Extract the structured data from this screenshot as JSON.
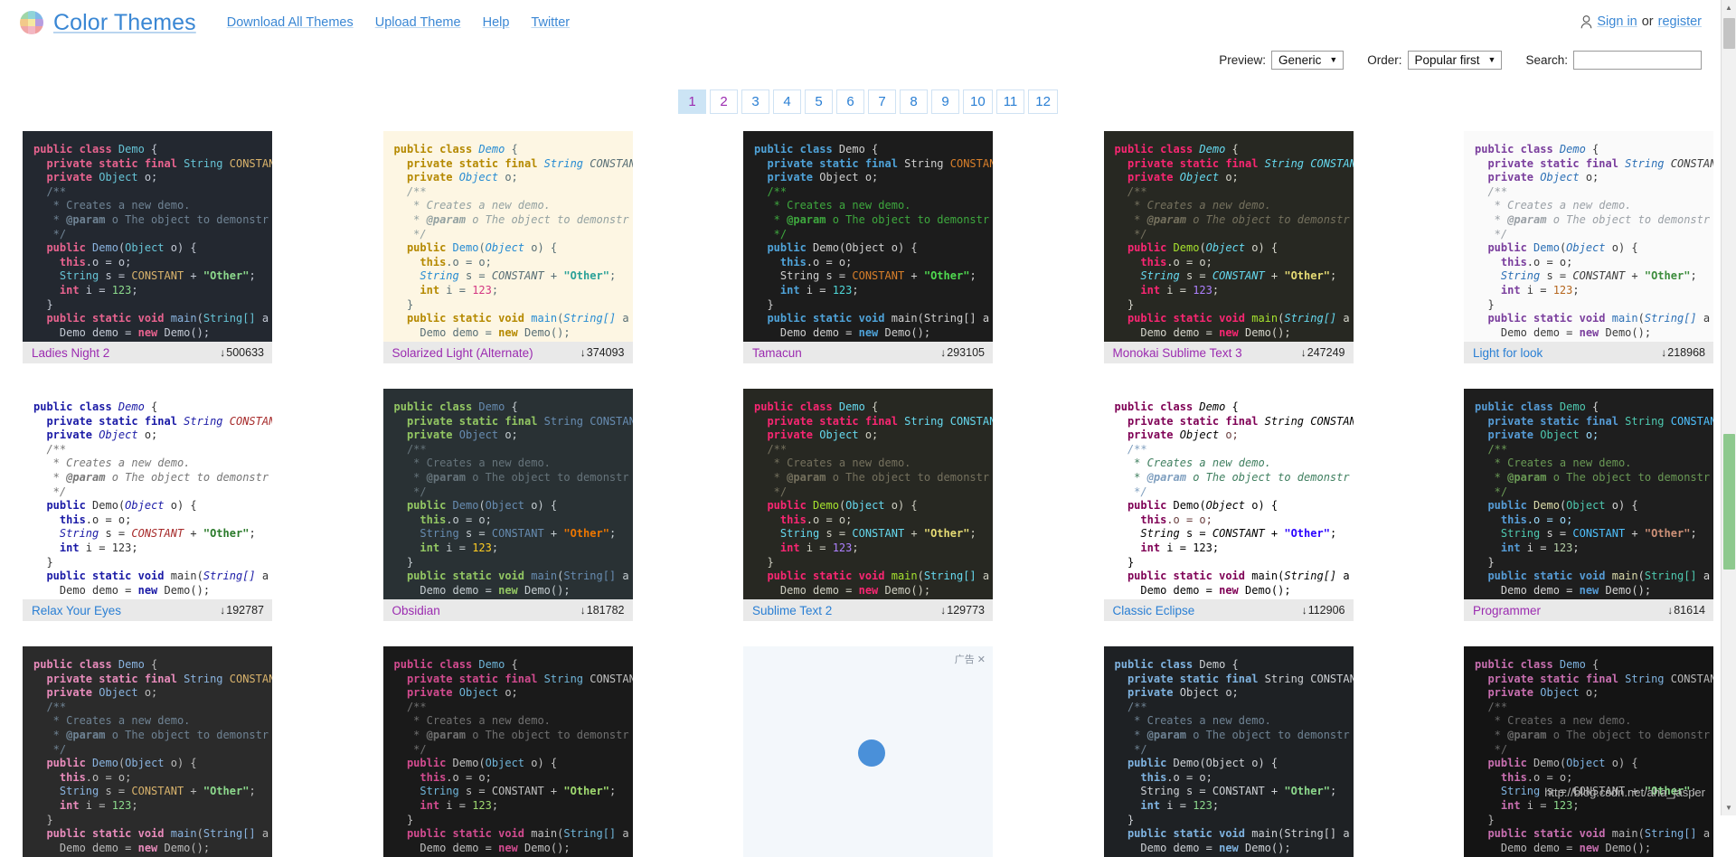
{
  "header": {
    "brand": "Color Themes",
    "logo_icon": "color-grid-logo",
    "nav": [
      {
        "label": "Download All Themes"
      },
      {
        "label": "Upload Theme"
      },
      {
        "label": "Help"
      },
      {
        "label": "Twitter"
      }
    ],
    "account": {
      "person_icon": "person-icon",
      "sign_in": "Sign in",
      "separator": "or",
      "register": "register"
    }
  },
  "controls": {
    "preview_label": "Preview:",
    "preview_value": "Generic",
    "order_label": "Order:",
    "order_value": "Popular first",
    "search_label": "Search:",
    "search_value": "",
    "search_placeholder": "",
    "caret_icon": "chevron-down-icon"
  },
  "pagination": {
    "pages": [
      "1",
      "2",
      "3",
      "4",
      "5",
      "6",
      "7",
      "8",
      "9",
      "10",
      "11",
      "12"
    ],
    "current": "1",
    "visited": [
      "1",
      "2"
    ]
  },
  "themes": [
    {
      "name": "Ladies Night 2",
      "downloads": "500633",
      "visited": true,
      "bg": "#232830",
      "text": "#c3c9d4",
      "kw": "#e8638f",
      "type": "#66c4d6",
      "str": "#8cd98c",
      "num": "#8cd98c",
      "cmt": "#6f8394",
      "cmt_tag": "#6f8394",
      "fn": "#8ab4e0",
      "var": "#c3c9d4",
      "const": "#d9b36c",
      "ital": false
    },
    {
      "name": "Solarized Light (Alternate)",
      "downloads": "374093",
      "visited": true,
      "bg": "#fdf6e3",
      "text": "#586e75",
      "kw": "#b58900",
      "type": "#268bd2",
      "str": "#2aa198",
      "num": "#d33682",
      "cmt": "#93a1a1",
      "cmt_tag": "#93a1a1",
      "fn": "#268bd2",
      "var": "#586e75",
      "const": "#586e75",
      "ital": true
    },
    {
      "name": "Tamacun",
      "downloads": "293105",
      "visited": true,
      "bg": "#1c1c1c",
      "text": "#cfcfcf",
      "kw": "#4fa3d9",
      "type": "#cfcfcf",
      "str": "#4fd94f",
      "num": "#4fd9d9",
      "cmt": "#3ea83e",
      "cmt_tag": "#3ea83e",
      "fn": "#cfcfcf",
      "var": "#cfcfcf",
      "const": "#d97f2a",
      "ital": false
    },
    {
      "name": "Monokai Sublime Text 3",
      "downloads": "247249",
      "visited": true,
      "bg": "#272822",
      "text": "#d6d6cc",
      "kw": "#f92672",
      "type": "#66d9ef",
      "str": "#e6db74",
      "num": "#ae81ff",
      "cmt": "#75715e",
      "cmt_tag": "#75715e",
      "fn": "#a6e22e",
      "var": "#d6d6cc",
      "const": "#66d9ef",
      "ital": true
    },
    {
      "name": "Light for look",
      "downloads": "218968",
      "visited": false,
      "bg": "#fafafa",
      "text": "#3b3b3b",
      "kw": "#7a3e9d",
      "type": "#2b6fb5",
      "str": "#3c8c3c",
      "num": "#b5651d",
      "cmt": "#9aa0a6",
      "cmt_tag": "#9aa0a6",
      "fn": "#2b6fb5",
      "var": "#3b3b3b",
      "const": "#3b3b3b",
      "ital": true
    },
    {
      "name": "Relax Your Eyes",
      "downloads": "192787",
      "visited": false,
      "bg": "#ffffff",
      "text": "#333333",
      "kw": "#1a1aa6",
      "type": "#1a1aa6",
      "str": "#2a7a2a",
      "num": "#333333",
      "cmt": "#777777",
      "cmt_tag": "#777777",
      "fn": "#333333",
      "var": "#333333",
      "const": "#a62a2a",
      "ital": true
    },
    {
      "name": "Obsidian",
      "downloads": "181782",
      "visited": true,
      "bg": "#293134",
      "text": "#c5cdd1",
      "kw": "#93c763",
      "type": "#678cb1",
      "str": "#ec7600",
      "num": "#ffcd22",
      "cmt": "#66747b",
      "cmt_tag": "#66747b",
      "fn": "#678cb1",
      "var": "#c5cdd1",
      "const": "#678cb1",
      "ital": false
    },
    {
      "name": "Sublime Text 2",
      "downloads": "129773",
      "visited": false,
      "bg": "#272822",
      "text": "#cfcfc2",
      "kw": "#f92672",
      "type": "#66d9ef",
      "str": "#e6db74",
      "num": "#ae81ff",
      "cmt": "#75715e",
      "cmt_tag": "#75715e",
      "fn": "#a6e22e",
      "var": "#cfcfc2",
      "const": "#66d9ef",
      "ital": false
    },
    {
      "name": "Classic Eclipse",
      "downloads": "112906",
      "visited": false,
      "bg": "#ffffff",
      "text": "#000000",
      "kw": "#7f0055",
      "type": "#000000",
      "str": "#2a00ff",
      "num": "#000000",
      "cmt": "#3f7f5f",
      "cmt_tag": "#7f9fbf",
      "fn": "#000000",
      "var": "#6a3e3e",
      "const": "#000000",
      "ital": true
    },
    {
      "name": "Programmer",
      "downloads": "81614",
      "visited": true,
      "bg": "#1e1e1e",
      "text": "#d4d4d4",
      "kw": "#569cd6",
      "type": "#4ec9b0",
      "str": "#ce9178",
      "num": "#b5cea8",
      "cmt": "#6a9955",
      "cmt_tag": "#6a9955",
      "fn": "#dcdcaa",
      "var": "#9cdcfe",
      "const": "#4fc1ff",
      "ital": false
    },
    {
      "name": "",
      "downloads": "",
      "visited": true,
      "bg": "#2b2b2b",
      "text": "#bbbbbb",
      "kw": "#e88bbb",
      "type": "#8ab4e0",
      "str": "#8cd98c",
      "num": "#8cd98c",
      "cmt": "#6f8394",
      "cmt_tag": "#6f8394",
      "fn": "#8ab4e0",
      "var": "#bbbbbb",
      "const": "#d9b36c",
      "ital": false
    },
    {
      "name": "",
      "downloads": "",
      "visited": true,
      "bg": "#1a1a1a",
      "text": "#c0c0c0",
      "kw": "#d24b8f",
      "type": "#6fb5d9",
      "str": "#9fd96f",
      "num": "#9fd96f",
      "cmt": "#707070",
      "cmt_tag": "#707070",
      "fn": "#c0c0c0",
      "var": "#c0c0c0",
      "const": "#c0c0c0",
      "ital": false
    },
    {
      "name": "",
      "downloads": "",
      "visited": false,
      "bg": "#f3f7fb",
      "text": "#333",
      "kw": "#333",
      "type": "#333",
      "str": "#333",
      "num": "#333",
      "cmt": "#333",
      "cmt_tag": "#333",
      "fn": "#333",
      "var": "#333",
      "const": "#333",
      "ital": false,
      "is_ad": true,
      "ad_label": "广告"
    },
    {
      "name": "",
      "downloads": "",
      "visited": false,
      "bg": "#1e2124",
      "text": "#cfd2d6",
      "kw": "#7fb3e0",
      "type": "#cfd2d6",
      "str": "#8cd98c",
      "num": "#8cd98c",
      "cmt": "#6f8394",
      "cmt_tag": "#6f8394",
      "fn": "#cfd2d6",
      "var": "#cfd2d6",
      "const": "#cfd2d6",
      "ital": false
    },
    {
      "name": "",
      "downloads": "",
      "visited": true,
      "bg": "#141414",
      "text": "#b9b9b9",
      "kw": "#c86fb0",
      "type": "#7fb3e0",
      "str": "#8cd98c",
      "num": "#8cd98c",
      "cmt": "#6a6a6a",
      "cmt_tag": "#6a6a6a",
      "fn": "#b9b9b9",
      "var": "#b9b9b9",
      "const": "#b9b9b9",
      "ital": false
    }
  ],
  "code": {
    "l1_kw": "public class",
    "l1_type": " Demo",
    "l1_brace": " {",
    "l2": "  private static final String CONSTAN",
    "l3": "  private Object o;",
    "l4": "  /**",
    "l5": "   * Creates a new demo.",
    "l6": "   * @param o The object to demonstr",
    "l7": "   */",
    "l8": "  public Demo(Object o) {",
    "l9": "    this.o = o;",
    "l10": "    String s = CONSTANT + \"Other\";",
    "l11": "    int i = 123;",
    "l12": "  }",
    "l13": "  public static void main(String[] a",
    "l14": "    Demo demo = new Demo();"
  },
  "watermark": "http://blog.csdn.net/aha_jasper",
  "icons": {
    "download_arrow": "download-arrow-icon",
    "scroll_up": "chevron-up-icon",
    "scroll_down": "chevron-down-icon"
  }
}
